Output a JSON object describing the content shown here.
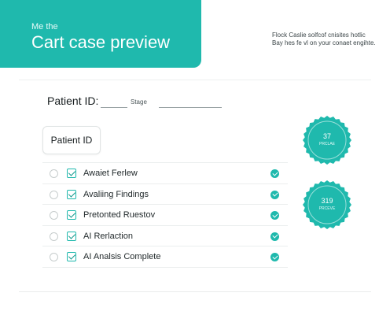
{
  "header": {
    "eyebrow": "Me the",
    "title": "Cart case preview"
  },
  "side_note": "Flock Caslie solfcof cnisites hotlic Bay hes fe vl on your conaet engihte.",
  "form": {
    "patient_label": "Patient ID:",
    "stage_label": "Stage",
    "id_box_label": "Patient ID"
  },
  "checklist": [
    {
      "label": "Awaiet Ferlew"
    },
    {
      "label": "Avaliing Findings"
    },
    {
      "label": "Pretonted Ruestov"
    },
    {
      "label": "AI Rerlaction"
    },
    {
      "label": "AI Analsis Complete"
    }
  ],
  "seals": [
    {
      "value": "37",
      "label": "PRCLAE"
    },
    {
      "value": "319",
      "label": "PRCEVE"
    }
  ],
  "colors": {
    "accent": "#1fb9ad"
  }
}
